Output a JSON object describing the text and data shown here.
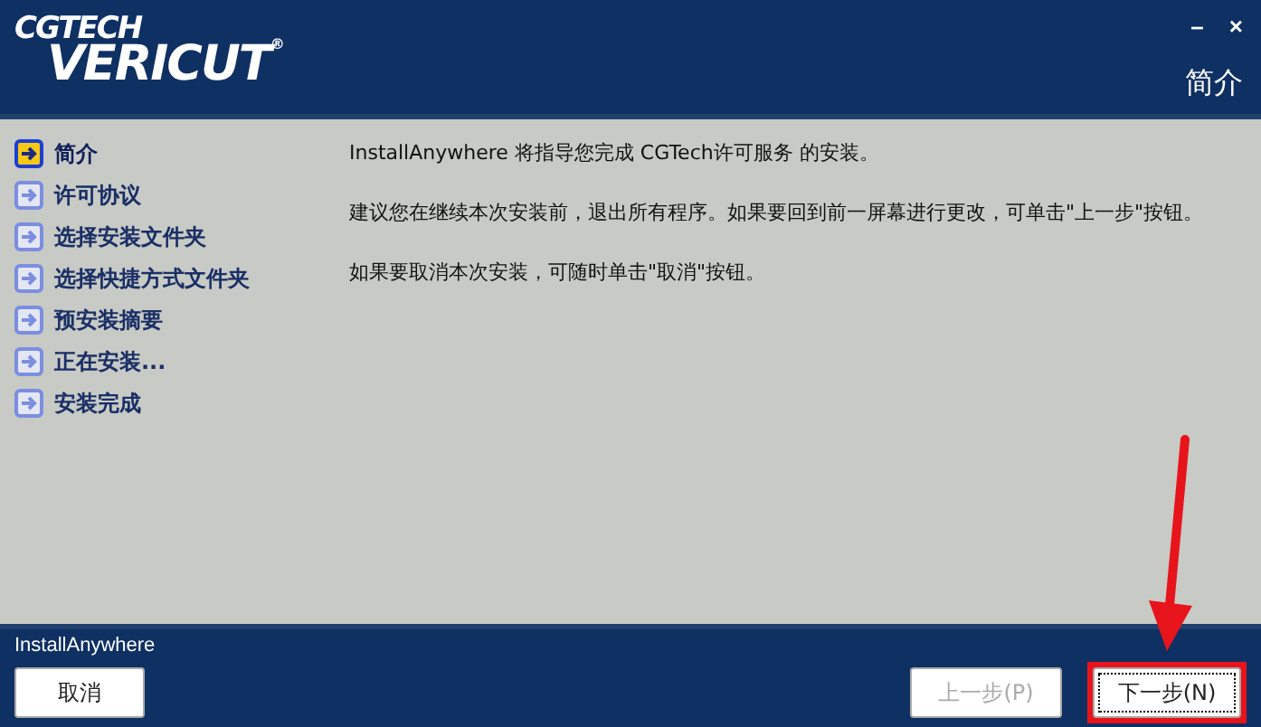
{
  "logo": {
    "brand": "CGTECH",
    "product": "VERICUT",
    "mark": "®"
  },
  "window_controls": {
    "minimize": "–",
    "close": "×"
  },
  "header": {
    "title": "简介"
  },
  "steps": [
    {
      "label": "简介",
      "selected": true
    },
    {
      "label": "许可协议",
      "selected": false
    },
    {
      "label": "选择安装文件夹",
      "selected": false
    },
    {
      "label": "选择快捷方式文件夹",
      "selected": false
    },
    {
      "label": "预安装摘要",
      "selected": false
    },
    {
      "label": "正在安装...",
      "selected": false
    },
    {
      "label": "安装完成",
      "selected": false
    }
  ],
  "paragraphs": [
    "InstallAnywhere 将指导您完成 CGTech许可服务 的安装。",
    "建议您在继续本次安装前，退出所有程序。如果要回到前一屏幕进行更改，可单击\"上一步\"按钮。",
    "如果要取消本次安装，可随时单击\"取消\"按钮。"
  ],
  "footer": {
    "brand": "InstallAnywhere"
  },
  "buttons": {
    "cancel": {
      "label": "取消",
      "disabled": false
    },
    "previous": {
      "label": "上一步(P)",
      "disabled": true
    },
    "next": {
      "label": "下一步(N)",
      "disabled": false,
      "highlighted": true
    }
  }
}
